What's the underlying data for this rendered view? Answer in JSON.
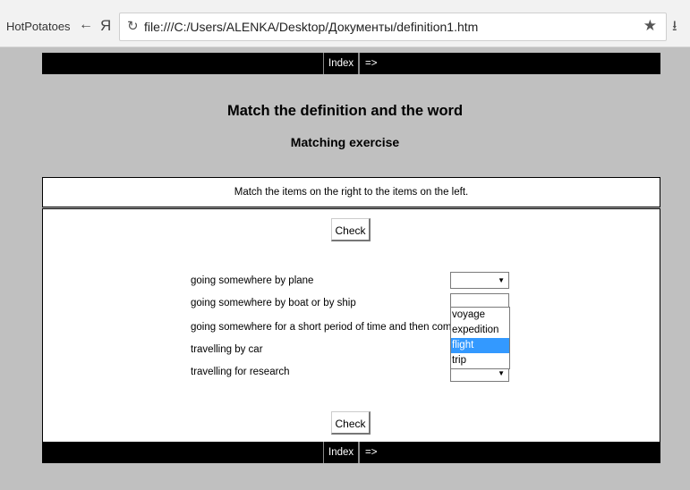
{
  "browser": {
    "app_name": "HotPotatoes",
    "back_glyph": "←",
    "ya_logo": "Я",
    "reload_glyph": "↻",
    "url": "file:///C:/Users/ALENKA/Desktop/Документы/definition1.htm",
    "star_glyph": "★",
    "download_glyph": "⭳"
  },
  "nav": {
    "index_label": "Index",
    "next_label": "=>"
  },
  "title": "Match the definition and the word",
  "subtitle": "Matching exercise",
  "instructions": "Match the items on the right to the items on the left.",
  "check_label": "Check",
  "items": [
    "going somewhere by plane",
    "going somewhere by boat or by ship",
    "going somewhere for a short period of time and then coming back",
    "travelling by car",
    "travelling for research"
  ],
  "select_arrow": "▼",
  "dropdown_options": [
    "",
    "voyage",
    "expedition",
    "flight",
    "trip"
  ],
  "highlight_color": "#3399ff"
}
